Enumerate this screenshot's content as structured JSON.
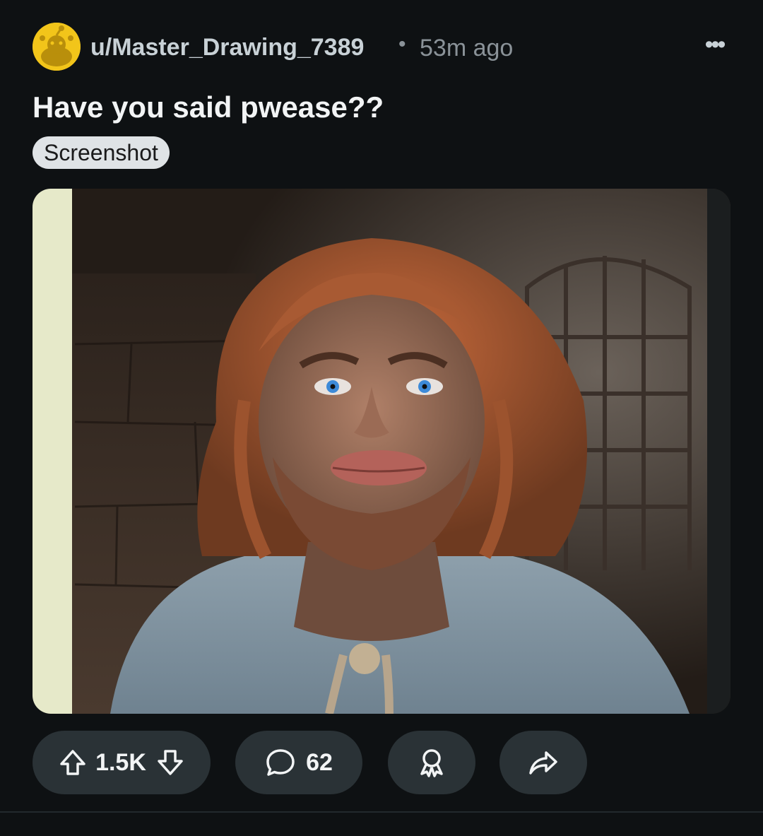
{
  "post": {
    "username": "u/Master_Drawing_7389",
    "separator": "•",
    "time_ago": "53m ago",
    "more_label": "•••",
    "title": "Have you said pwease??",
    "flair": "Screenshot"
  },
  "actions": {
    "upvotes": "1.5K",
    "comments": "62"
  },
  "icons": {
    "avatar": "reddit-avatar-icon",
    "upvote": "arrow-up-icon",
    "downvote": "arrow-down-icon",
    "comment": "speech-bubble-icon",
    "award": "award-ribbon-icon",
    "share": "share-arrow-icon",
    "more": "more-dots-icon"
  },
  "colors": {
    "background": "#0e1113",
    "avatar_yellow": "#f2c51a",
    "pill_background": "#2a3236",
    "flair_background": "#dfe3e6"
  }
}
